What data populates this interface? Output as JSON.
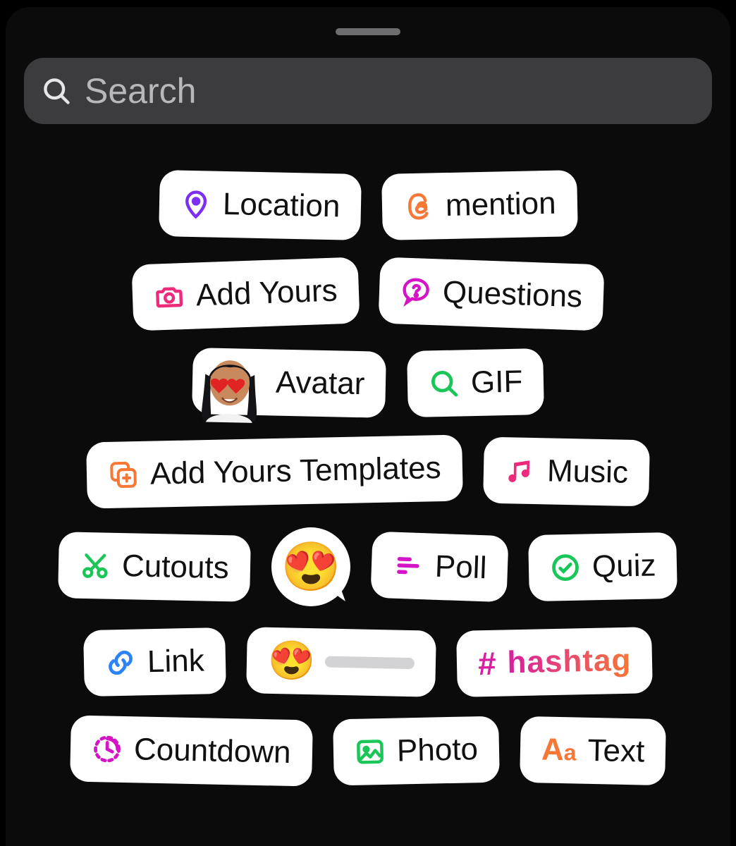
{
  "search": {
    "placeholder": "Search"
  },
  "stickers": {
    "location": {
      "label": "Location",
      "color": "#7b2ff2"
    },
    "mention": {
      "label": "mention",
      "color": "#f77737"
    },
    "addyours": {
      "label": "Add Yours",
      "color": "#ed2a7b"
    },
    "questions": {
      "label": "Questions",
      "color": "#d415c5"
    },
    "avatar": {
      "label": "Avatar"
    },
    "gif": {
      "label": "GIF",
      "color": "#19c657"
    },
    "templates": {
      "label": "Add Yours Templates",
      "color": "#f77737"
    },
    "music": {
      "label": "Music",
      "color": "#ed2a7b"
    },
    "cutouts": {
      "label": "Cutouts",
      "color": "#19c657"
    },
    "emoji": {
      "glyph": "😍"
    },
    "poll": {
      "label": "Poll",
      "color": "#d415c5"
    },
    "quiz": {
      "label": "Quiz",
      "color": "#19c657"
    },
    "link": {
      "label": "Link",
      "color": "#2b83f6"
    },
    "slider": {
      "glyph": "😍"
    },
    "hashtag": {
      "prefix": "#",
      "label": "hashtag"
    },
    "countdown": {
      "label": "Countdown",
      "color": "#d415c5"
    },
    "photo": {
      "label": "Photo",
      "color": "#19c657"
    },
    "text": {
      "label": "Text",
      "prefix_big": "A",
      "prefix_small": "a",
      "color": "#f77737"
    }
  }
}
